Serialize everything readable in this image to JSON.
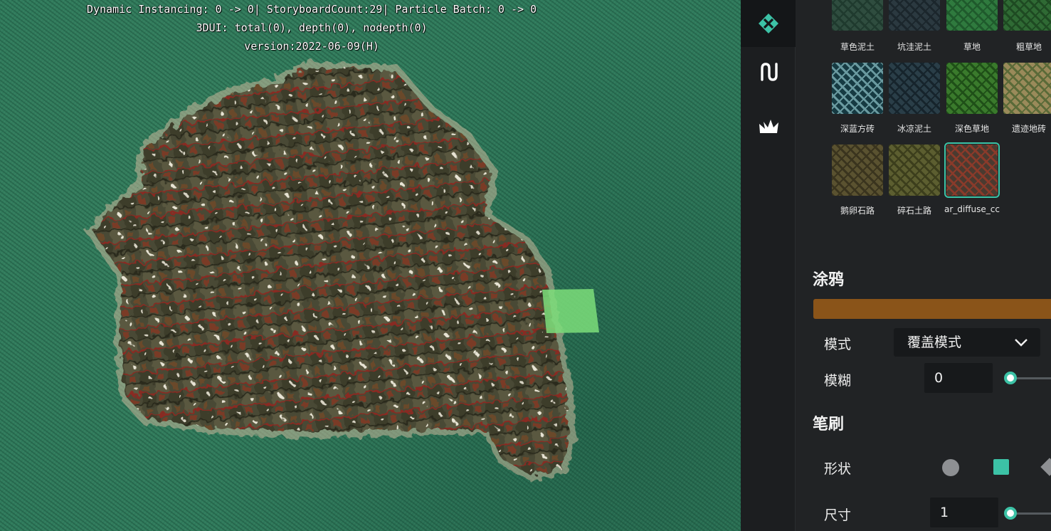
{
  "viewport": {
    "debug_lines": [
      "Dynamic Instancing: 0 -> 0| StoryboardCount:29| Particle Batch: 0 -> 0",
      "3DUI: total(0), depth(0), nodepth(0)",
      "version:2022-06-09(H)"
    ]
  },
  "toolstrip": {
    "tools": [
      {
        "icon": "terrain-paint-icon",
        "active": true
      },
      {
        "icon": "path-icon",
        "active": false
      },
      {
        "icon": "grass-icon",
        "active": false
      }
    ]
  },
  "textures": [
    {
      "label": "草色泥土",
      "color": "#2f4d3f",
      "accent": "#1f3a2e"
    },
    {
      "label": "坑洼泥土",
      "color": "#2b3940",
      "accent": "#1b262c"
    },
    {
      "label": "草地",
      "color": "#2f7a3e",
      "accent": "#1f5a2c"
    },
    {
      "label": "粗草地",
      "color": "#2f6a34",
      "accent": "#1e4a22"
    },
    {
      "label": "深蓝方砖",
      "color": "#163a42",
      "accent": "#6a9aa0"
    },
    {
      "label": "冰凉泥土",
      "color": "#2a3e48",
      "accent": "#16242c"
    },
    {
      "label": "深色草地",
      "color": "#3a7a2c",
      "accent": "#1f4f18"
    },
    {
      "label": "遗迹地砖",
      "color": "#9a8a5a",
      "accent": "#5a6a38"
    },
    {
      "label": "鹅卵石路",
      "color": "#5a5230",
      "accent": "#3a341e"
    },
    {
      "label": "碎石土路",
      "color": "#5c5e30",
      "accent": "#3c3e1c"
    },
    {
      "label": "ar_diffuse_cc",
      "color": "#4a3a30",
      "accent": "#8a3a2a",
      "selected": true
    }
  ],
  "graffiti": {
    "title": "涂鸦",
    "color": "#8a5419",
    "mode_label": "模式",
    "mode_value": "覆盖模式",
    "blur_label": "模糊",
    "blur_value": "0",
    "blur_level": 0
  },
  "brush": {
    "title": "笔刷",
    "shape_label": "形状",
    "shapes": [
      "circle",
      "square",
      "diamond"
    ],
    "selected_shape": "square",
    "size_label": "尺寸",
    "size_value": "1",
    "size_level": 0
  },
  "colors": {
    "accent": "#3cc2a6",
    "panel_bg": "#212325",
    "grass": "#2f7a5c"
  }
}
